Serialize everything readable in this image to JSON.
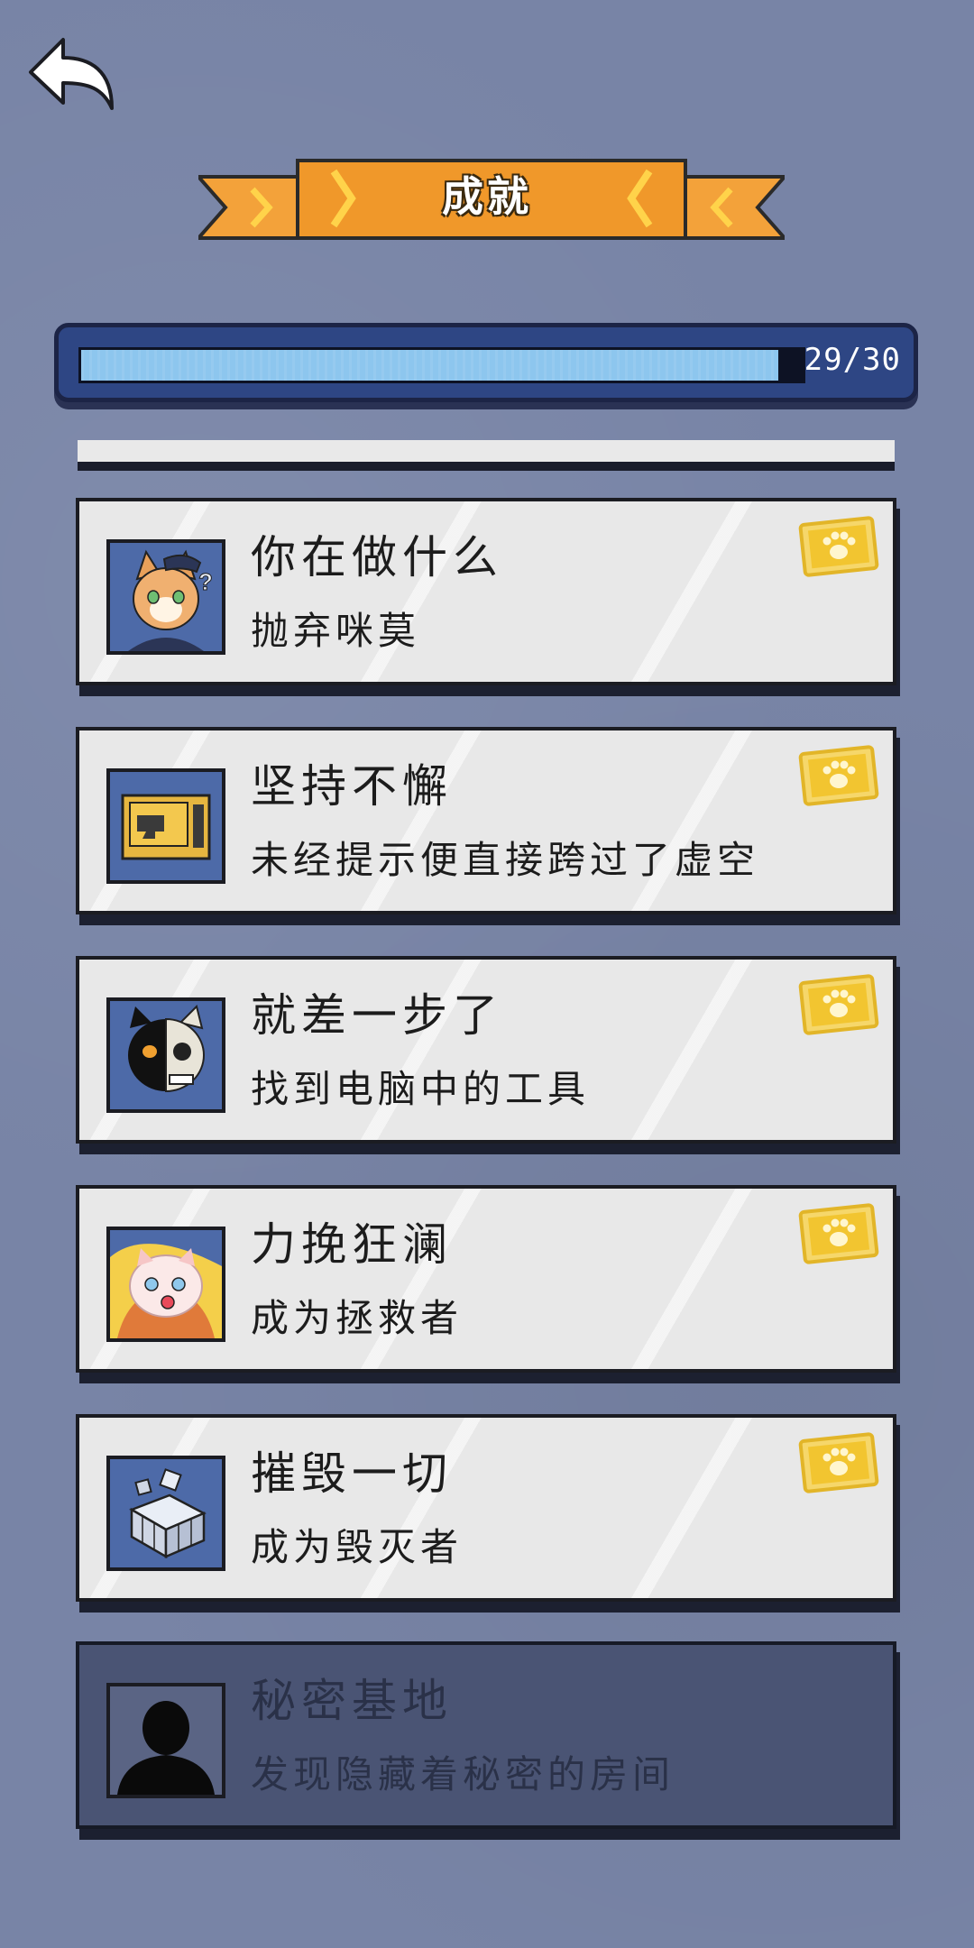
{
  "header": {
    "title": "成就",
    "back_icon": "back-arrow-icon"
  },
  "progress": {
    "value": 29,
    "max": 30,
    "label": "29/30"
  },
  "achievements": [
    {
      "title": "你在做什么",
      "description": "抛弃咪莫",
      "icon": "police-cat-icon",
      "unlocked": true
    },
    {
      "title": "坚持不懈",
      "description": "未经提示便直接跨过了虚空",
      "icon": "computer-monitor-icon",
      "unlocked": true
    },
    {
      "title": "就差一步了",
      "description": "找到电脑中的工具",
      "icon": "skull-cat-icon",
      "unlocked": true
    },
    {
      "title": "力挽狂澜",
      "description": "成为拯救者",
      "icon": "baby-cat-icon",
      "unlocked": true
    },
    {
      "title": "摧毁一切",
      "description": "成为毁灭者",
      "icon": "cube-blocks-icon",
      "unlocked": true
    },
    {
      "title": "秘密基地",
      "description": "发现隐藏着秘密的房间",
      "icon": "silhouette-icon",
      "unlocked": false
    }
  ],
  "colors": {
    "background": "#7884a6",
    "banner": "#f09a2a",
    "progress_fill": "#8dc6ee",
    "card": "#e8e8e8",
    "locked_card": "#4a5474",
    "badge": "#f2c530"
  }
}
